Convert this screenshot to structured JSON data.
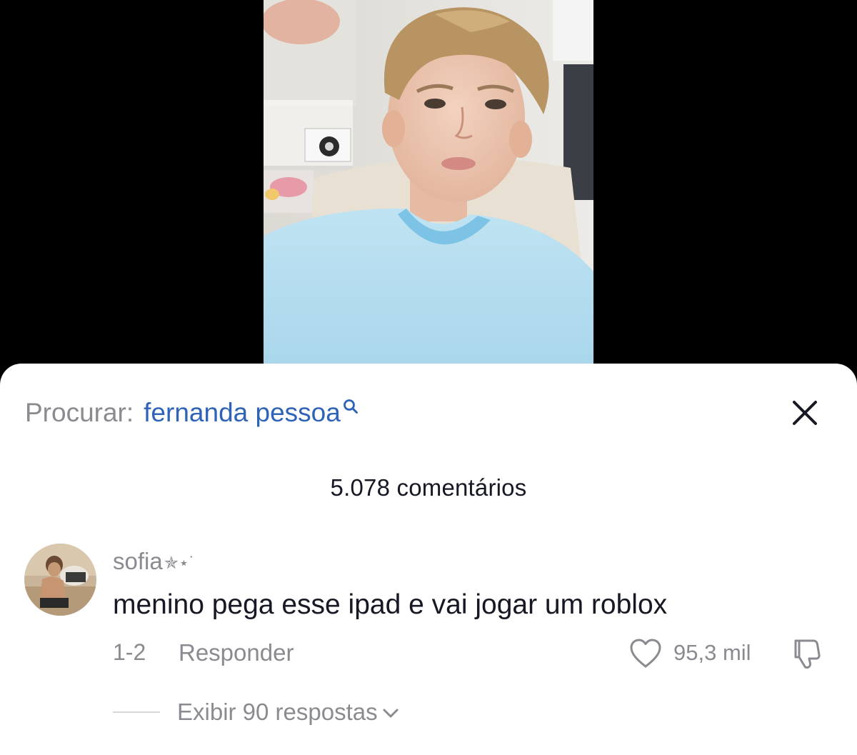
{
  "search": {
    "prefix": "Procurar:",
    "term": "fernanda pessoa"
  },
  "comments_header": {
    "count_label": "5.078 comentários"
  },
  "comment": {
    "username": "sofia",
    "username_decoration": "✯⋆˙",
    "text": "menino pega esse ipad e vai jogar um roblox",
    "date": "1-2",
    "reply_label": "Responder",
    "like_count": "95,3 mil",
    "view_replies_label": "Exibir 90 respostas"
  },
  "colors": {
    "search_term": "#2f63b8",
    "secondary_text": "#8a8b91",
    "primary_text": "#161823",
    "sheet_background": "#ffffff",
    "letterbox": "#000000"
  },
  "icons": {
    "search": "search-icon",
    "close": "close-icon",
    "like": "heart-outline-icon",
    "dislike": "thumbs-down-icon",
    "expand": "chevron-down-icon"
  }
}
